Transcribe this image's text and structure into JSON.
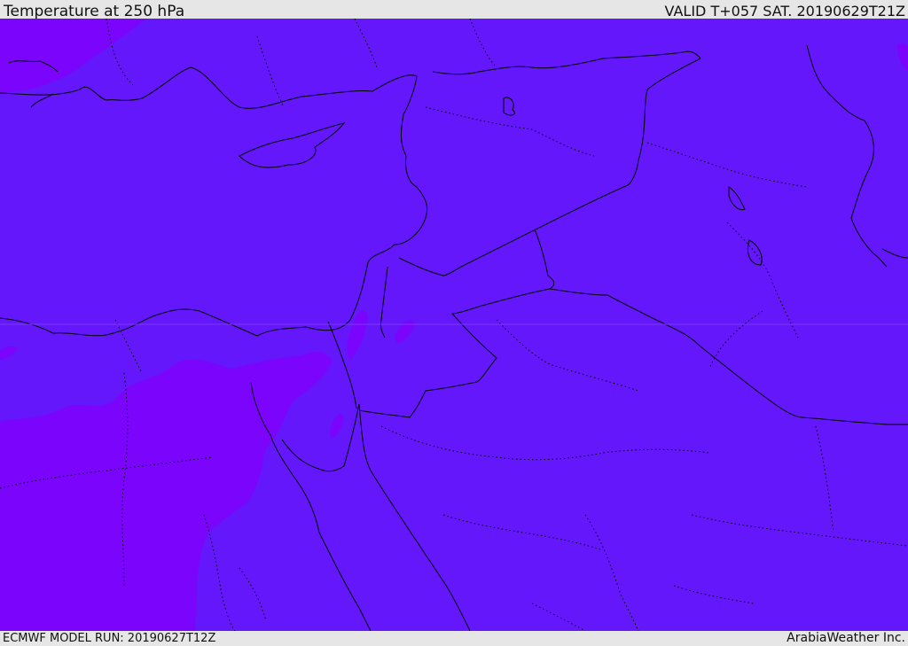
{
  "header": {
    "title": "Temperature at 250 hPa",
    "valid": "VALID T+057 SAT. 20190629T21Z"
  },
  "footer": {
    "model_run": "ECMWF MODEL RUN: 20190627T12Z",
    "credit": "ArabiaWeather Inc."
  },
  "map": {
    "field": "temperature",
    "level": "250 hPa",
    "region": "Eastern Mediterranean / Middle East",
    "colors": {
      "main_field": "#6417fb",
      "warm_patch": "#7a04fc",
      "coastline": "#000000",
      "border": "#000000"
    }
  }
}
